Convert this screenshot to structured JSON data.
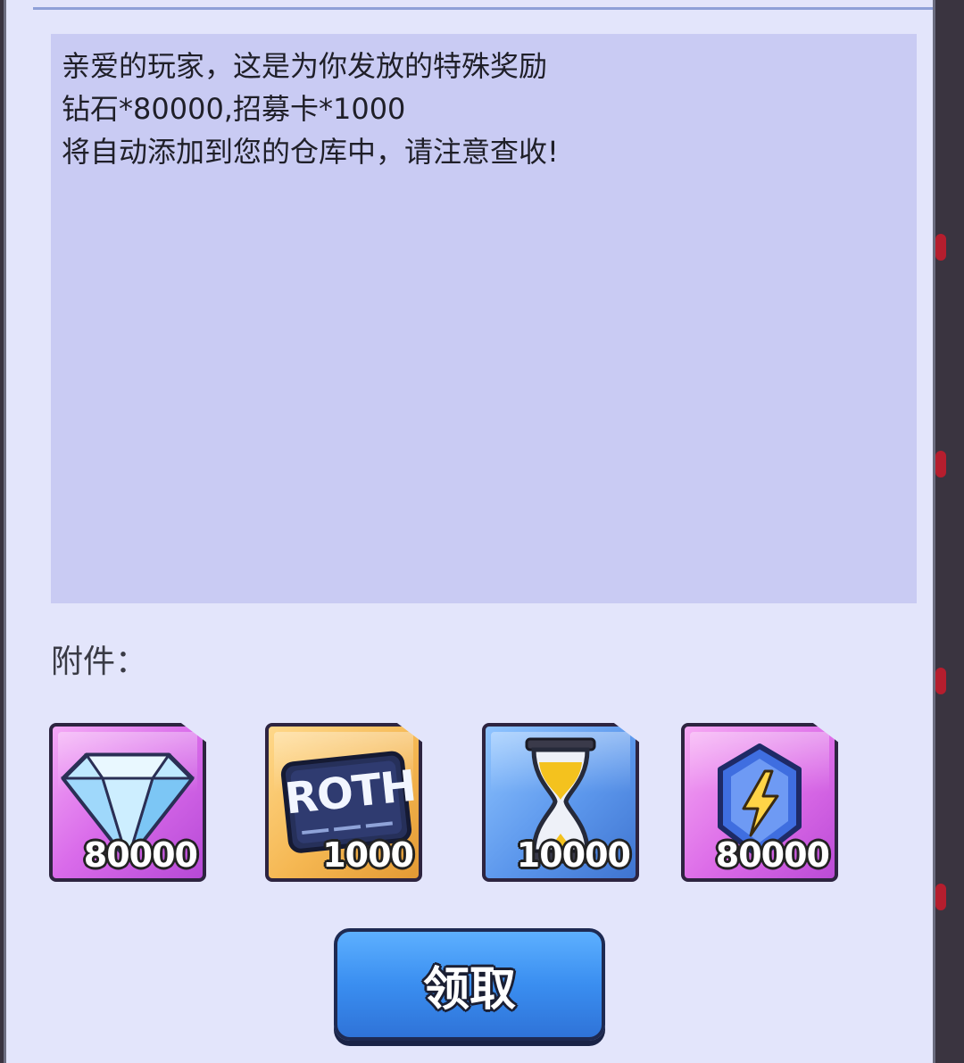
{
  "message": {
    "lines": [
      "亲爱的玩家，这是为你发放的特殊奖励",
      "钻石*80000,招募卡*1000",
      "将自动添加到您的仓库中，请注意查收!"
    ]
  },
  "attachments": {
    "label": "附件：",
    "items": [
      {
        "icon": "diamond-icon",
        "qty": "80000"
      },
      {
        "icon": "recruit-card-icon",
        "card_text": "ROTH",
        "qty": "1000"
      },
      {
        "icon": "hourglass-icon",
        "qty": "10000"
      },
      {
        "icon": "energy-crystal-icon",
        "qty": "80000"
      }
    ]
  },
  "claim_button": {
    "label": "领取"
  },
  "colors": {
    "panel_bg": "#e3e5fb",
    "message_bg": "#c9cbf3",
    "button": "#3a8ef0",
    "diamond_tile": "#d96bea",
    "card_tile": "#f5b752",
    "hourglass_tile": "#5c97ec",
    "energy_tile": "#dc6ce8"
  }
}
